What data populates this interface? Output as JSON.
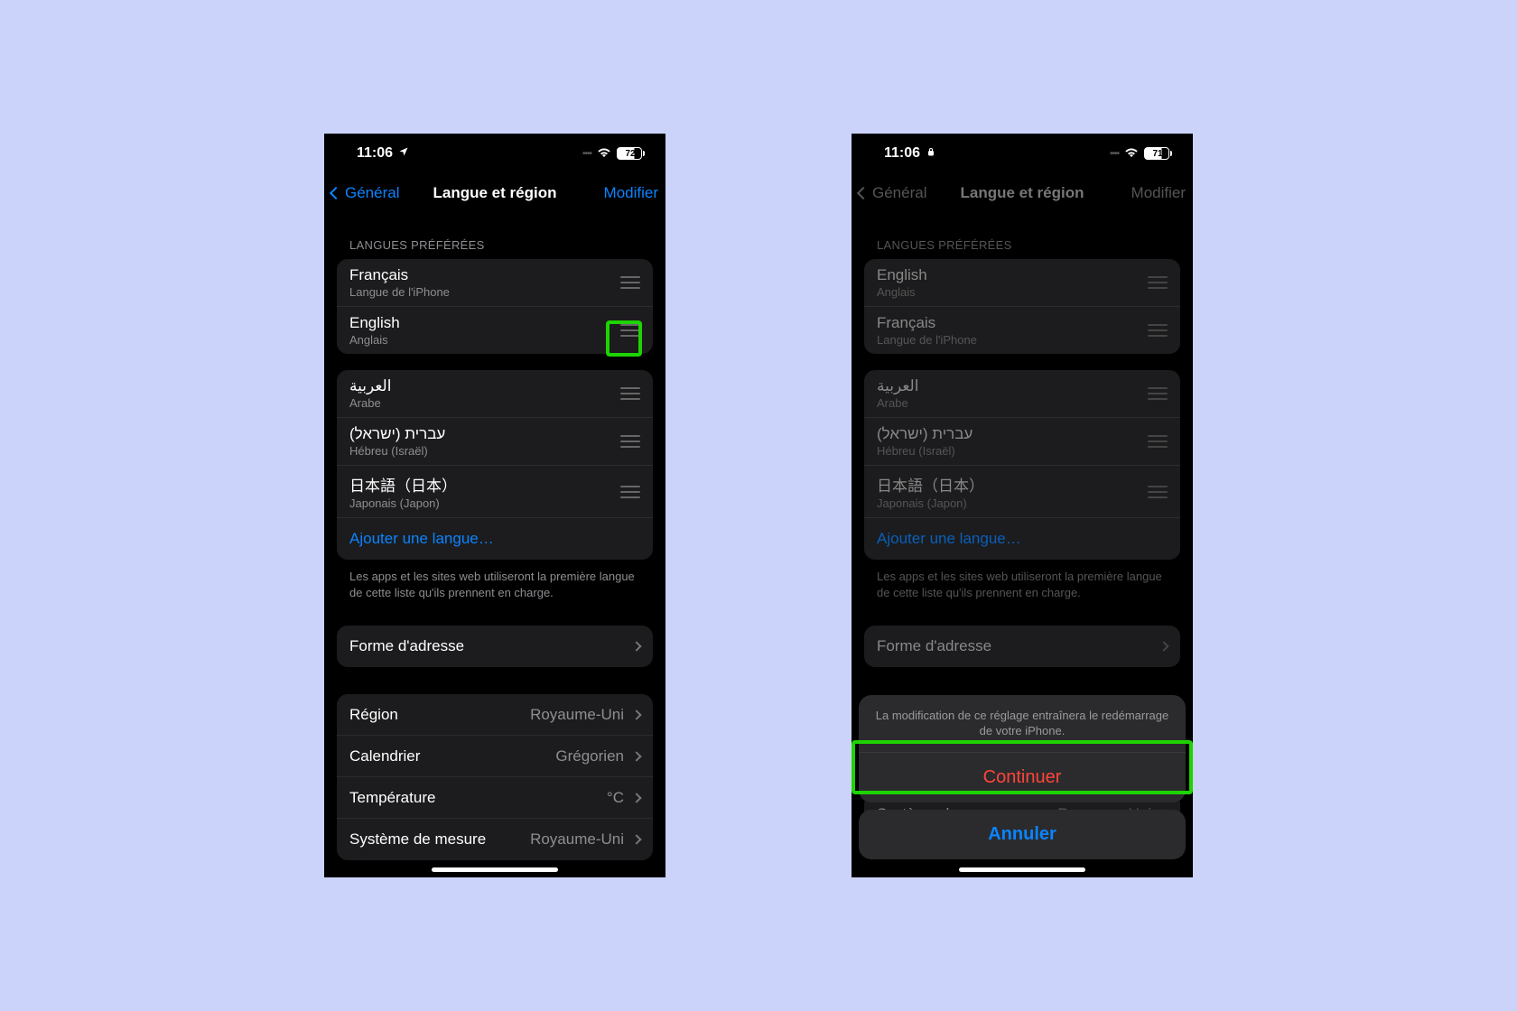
{
  "left": {
    "status": {
      "time": "11:06",
      "loc_icon": "location",
      "battery": "72"
    },
    "nav": {
      "back": "Général",
      "title": "Langue et région",
      "edit": "Modifier"
    },
    "sections": {
      "preferred_header": "LANGUES PRÉFÉRÉES"
    },
    "preferred": [
      {
        "name": "Français",
        "sub": "Langue de l'iPhone"
      },
      {
        "name": "English",
        "sub": "Anglais"
      }
    ],
    "other_langs": [
      {
        "name": "العربية",
        "sub": "Arabe"
      },
      {
        "name": "עברית (ישראל)",
        "sub": "Hébreu (Israël)"
      },
      {
        "name": "日本語（日本）",
        "sub": "Japonais (Japon)"
      }
    ],
    "add_lang": "Ajouter une langue…",
    "lang_footer": "Les apps et les sites web utiliseront la première langue de cette liste qu'ils prennent en charge.",
    "form_address": "Forme d'adresse",
    "region_rows": [
      {
        "label": "Région",
        "value": "Royaume-Uni"
      },
      {
        "label": "Calendrier",
        "value": "Grégorien"
      },
      {
        "label": "Température",
        "value": "°C"
      },
      {
        "label": "Système de mesure",
        "value": "Royaume-Uni"
      }
    ]
  },
  "right": {
    "status": {
      "time": "11:06",
      "battery": "71"
    },
    "nav": {
      "back": "Général",
      "title": "Langue et région",
      "edit": "Modifier"
    },
    "sections": {
      "preferred_header": "LANGUES PRÉFÉRÉES"
    },
    "preferred": [
      {
        "name": "English",
        "sub": "Anglais"
      },
      {
        "name": "Français",
        "sub": "Langue de l'iPhone"
      }
    ],
    "other_langs": [
      {
        "name": "العربية",
        "sub": "Arabe"
      },
      {
        "name": "עברית (ישראל)",
        "sub": "Hébreu (Israël)"
      },
      {
        "name": "日本語（日本）",
        "sub": "Japonais (Japon)"
      }
    ],
    "add_lang": "Ajouter une langue…",
    "lang_footer": "Les apps et les sites web utiliseront la première langue de cette liste qu'ils prennent en charge.",
    "form_address": "Forme d'adresse",
    "region_rows": [
      {
        "label": "Système de mesure",
        "value": "Royaume-Uni"
      }
    ],
    "sheet": {
      "message": "La modification de ce réglage entraînera le redémarrage de votre iPhone.",
      "continue": "Continuer",
      "cancel": "Annuler"
    }
  }
}
